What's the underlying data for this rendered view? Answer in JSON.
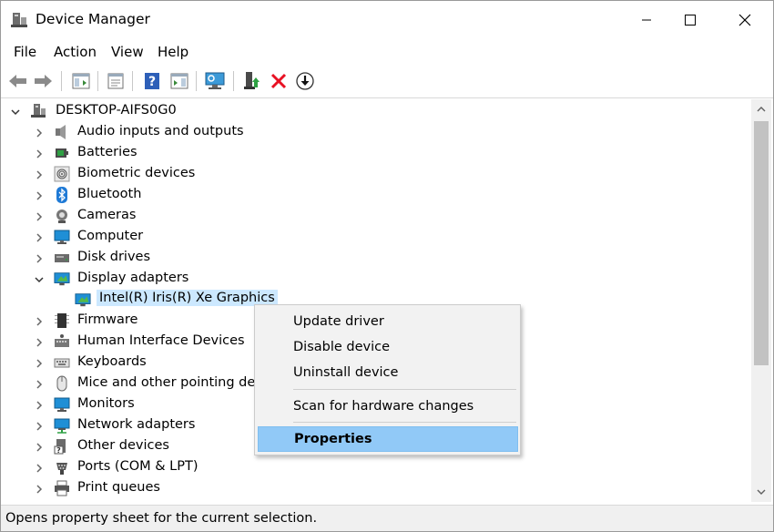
{
  "window": {
    "title": "Device Manager"
  },
  "menu": [
    "File",
    "Action",
    "View",
    "Help"
  ],
  "toolbar": {
    "icons": [
      "back-icon",
      "forward-icon",
      "show-hide-console-tree-icon",
      "properties-sheet-icon",
      "help-icon",
      "action-pane-icon",
      "scan-hardware-icon",
      "update-driver-icon",
      "uninstall-icon",
      "download-icon"
    ]
  },
  "tree": {
    "root": "DESKTOP-AIFS0G0",
    "categories": [
      {
        "label": "Audio inputs and outputs",
        "icon": "speaker-icon",
        "expanded": false
      },
      {
        "label": "Batteries",
        "icon": "battery-icon",
        "expanded": false
      },
      {
        "label": "Biometric devices",
        "icon": "fingerprint-icon",
        "expanded": false
      },
      {
        "label": "Bluetooth",
        "icon": "bluetooth-icon",
        "expanded": false
      },
      {
        "label": "Cameras",
        "icon": "camera-icon",
        "expanded": false
      },
      {
        "label": "Computer",
        "icon": "computer-icon",
        "expanded": false
      },
      {
        "label": "Disk drives",
        "icon": "disk-drive-icon",
        "expanded": false
      },
      {
        "label": "Display adapters",
        "icon": "display-adapter-icon",
        "expanded": true
      },
      {
        "label": "Firmware",
        "icon": "firmware-icon",
        "expanded": false
      },
      {
        "label": "Human Interface Devices",
        "icon": "hid-icon",
        "expanded": false
      },
      {
        "label": "Keyboards",
        "icon": "keyboard-icon",
        "expanded": false
      },
      {
        "label": "Mice and other pointing devi",
        "icon": "mouse-icon",
        "expanded": false
      },
      {
        "label": "Monitors",
        "icon": "monitor-icon",
        "expanded": false
      },
      {
        "label": "Network adapters",
        "icon": "network-adapter-icon",
        "expanded": false
      },
      {
        "label": "Other devices",
        "icon": "other-devices-icon",
        "expanded": false
      },
      {
        "label": "Ports (COM & LPT)",
        "icon": "port-icon",
        "expanded": false
      },
      {
        "label": "Print queues",
        "icon": "printer-icon",
        "expanded": false
      }
    ],
    "selected_device": "Intel(R) Iris(R) Xe Graphics"
  },
  "context_menu": {
    "items": [
      "Update driver",
      "Disable device",
      "Uninstall device",
      "Scan for hardware changes",
      "Properties"
    ],
    "highlighted": "Properties"
  },
  "status": {
    "text": "Opens property sheet for the current selection."
  },
  "colors": {
    "selection": "#cce8ff",
    "menu_highlight": "#91c9f7",
    "accent_blue": "#0078d7",
    "uninstall_red": "#e81123"
  }
}
